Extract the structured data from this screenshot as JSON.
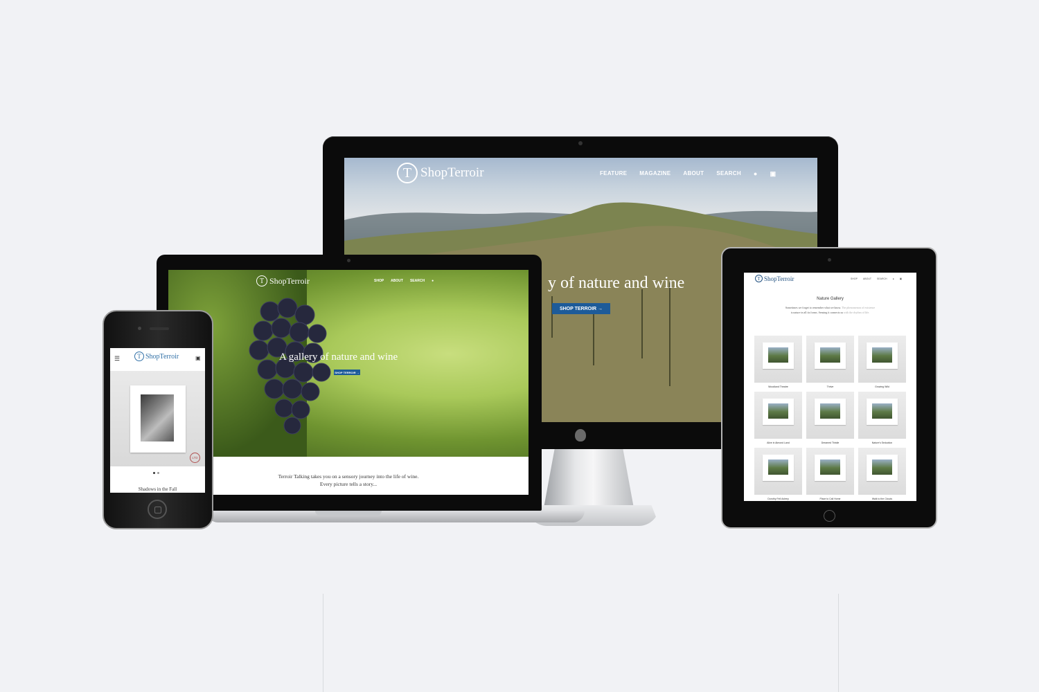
{
  "desktop": {
    "logo": "ShopTerroir",
    "logo_mark": "T",
    "nav": [
      "FEATURE",
      "MAGAZINE",
      "ABOUT",
      "SEARCH"
    ],
    "hero_text": "y of nature and wine",
    "cta": "SHOP TERROIR →"
  },
  "laptop": {
    "logo": "ShopTerroir",
    "logo_mark": "T",
    "nav": [
      "SHOP",
      "ABOUT",
      "SEARCH"
    ],
    "hero_text": "A gallery of nature and wine",
    "cta": "SHOP TERROIR →",
    "intro_line1": "Terroir Talking takes you on a sensory journey into the life of wine.",
    "intro_line2": "Every picture tells a story..."
  },
  "phone": {
    "logo": "ShopTerroir",
    "logo_mark": "T",
    "menu_icon": "☰",
    "cart_icon": "🛒",
    "badge": "LTD",
    "caption": "Shadows in the Fall"
  },
  "tablet": {
    "logo": "ShopTerroir",
    "logo_mark": "T",
    "nav": [
      "SHOP",
      "ABOUT",
      "SEARCH"
    ],
    "title": "Nature Gallery",
    "intro_line1a": "Sometimes we forget to remember what we know. ",
    "intro_line1b": "The phenomenon of existence",
    "intro_line2a": "is nature in all its forms. Sensing it connects us ",
    "intro_line2b": "with the rhythm of life.",
    "items": [
      "Woodland Theatre",
      "Thrive",
      "Growing Wild",
      "Alive in Almond Land",
      "Dreamed Thistle",
      "Nature's Seduction",
      "Dorothy Fell Asleep",
      "Place to Call Home",
      "Walk to the Clouds"
    ]
  },
  "colors": {
    "background": "#f1f2f5",
    "brand_blue": "#1d5b99",
    "bezel": "#0b0b0b"
  }
}
